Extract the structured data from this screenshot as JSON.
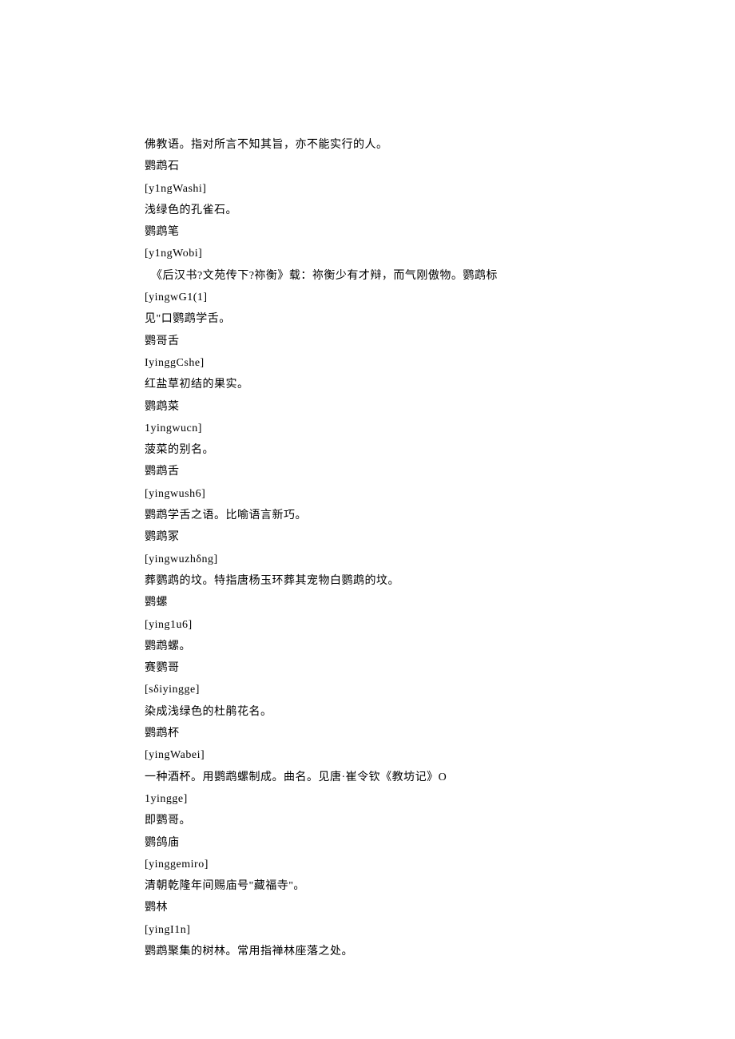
{
  "lines": [
    "佛教语。指对所言不知其旨，亦不能实行的人。",
    "鹦鹉石",
    "[y1ngWashi]",
    "浅绿色的孔雀石。",
    "鹦鹉笔",
    "[y1ngWobi]",
    "  《后汉书?文苑传下?祢衡》载：祢衡少有才辩，而气刚傲物。鹦鹉标",
    "[yingwG1(1]",
    "见\"口鹦鹉学舌。",
    "鹦哥舌",
    "IyinggCshe]",
    "红盐草初结的果实。",
    "鹦鹉菜",
    "1yingwucn]",
    "菠菜的别名。",
    "鹦鹉舌",
    "[yingwush6]",
    "鹦鹉学舌之语。比喻语言新巧。",
    "鹦鹉冢",
    "[yingwuzhδng]",
    "葬鹦鹉的坟。特指唐杨玉环葬其宠物白鹦鹉的坟。",
    "鹦螺",
    "[ying1u6]",
    "鹦鹉螺。",
    "赛鹦哥",
    "[sδiyingge]",
    "染成浅绿色的杜鹃花名。",
    "鹦鹉杯",
    "[yingWabei]",
    "一种酒杯。用鹦鹉螺制成。曲名。见唐·崔令钦《教坊记》O",
    "1yingge]",
    "即鹦哥。",
    "鹦鸽庙",
    "[yinggemiro]",
    "清朝乾隆年间赐庙号\"藏福寺\"。",
    "鹦林",
    "[yingI1n]",
    "鹦鹉聚集的树林。常用指禅林座落之处。"
  ]
}
